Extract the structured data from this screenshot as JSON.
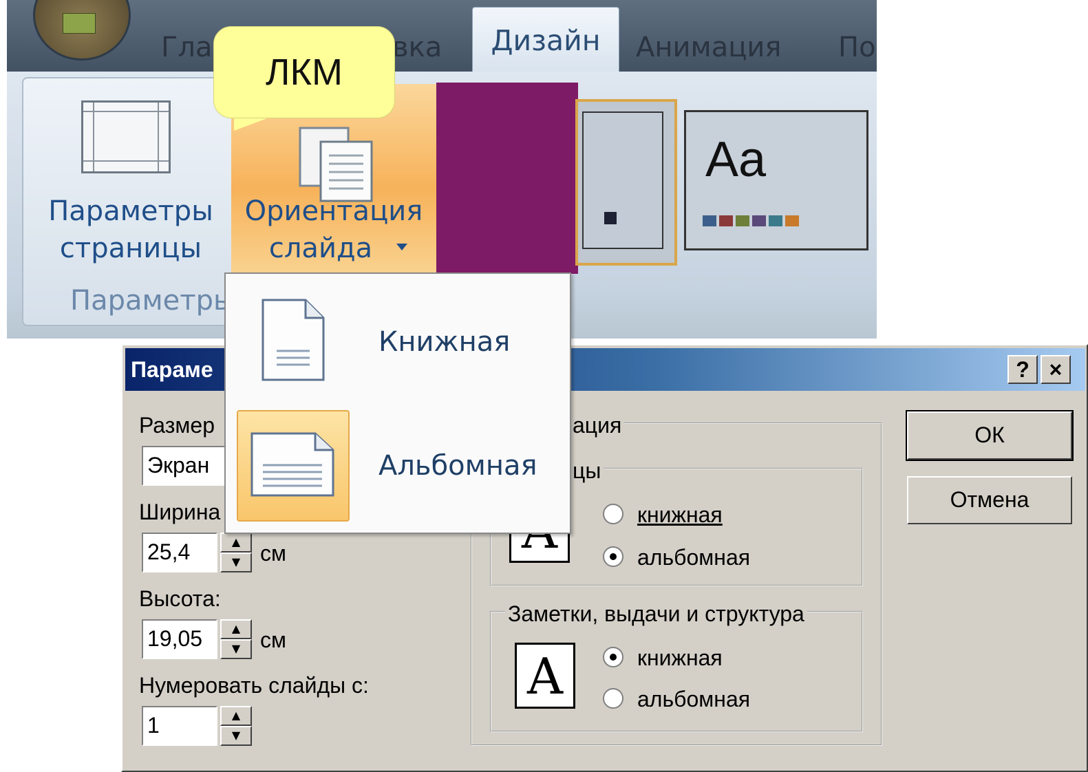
{
  "ribbon": {
    "tabs": [
      {
        "label": "Глав"
      },
      {
        "label": "вка"
      },
      {
        "label": "Дизайн"
      },
      {
        "label": "Анимация"
      },
      {
        "label": "По"
      }
    ],
    "page_setup": {
      "line1": "Параметры",
      "line2": "страницы"
    },
    "orientation": {
      "line1": "Ориентация",
      "line2": "слайда"
    },
    "group_label": "Параметры",
    "theme_thumb_text": "Aa",
    "swatch_colors": [
      "#3b5f8a",
      "#8b3a3a",
      "#6e7f3a",
      "#5a4a7a",
      "#3a7a8a",
      "#c87a2a"
    ]
  },
  "callout": {
    "text": "ЛКМ"
  },
  "dropdown": {
    "items": [
      {
        "label": "Книжная"
      },
      {
        "label": "Альбомная"
      }
    ]
  },
  "dialog": {
    "title": "Параме",
    "help_button": "?",
    "close_button": "×",
    "size_label": "Размер",
    "size_value": "Экран",
    "width_label": "Ширина",
    "width_value": "25,4",
    "width_unit": "см",
    "height_label": "Высота:",
    "height_value": "19,05",
    "height_unit": "см",
    "number_label": "Нумеровать слайды с:",
    "number_value": "1",
    "orientation_group": "ация",
    "slides_group": "цы",
    "slides_portrait": "книжная",
    "slides_landscape": "альбомная",
    "notes_group": "Заметки, выдачи и структура",
    "notes_portrait": "книжная",
    "notes_landscape": "альбомная",
    "icon_letter": "A",
    "ok": "ОК",
    "cancel": "Отмена"
  }
}
